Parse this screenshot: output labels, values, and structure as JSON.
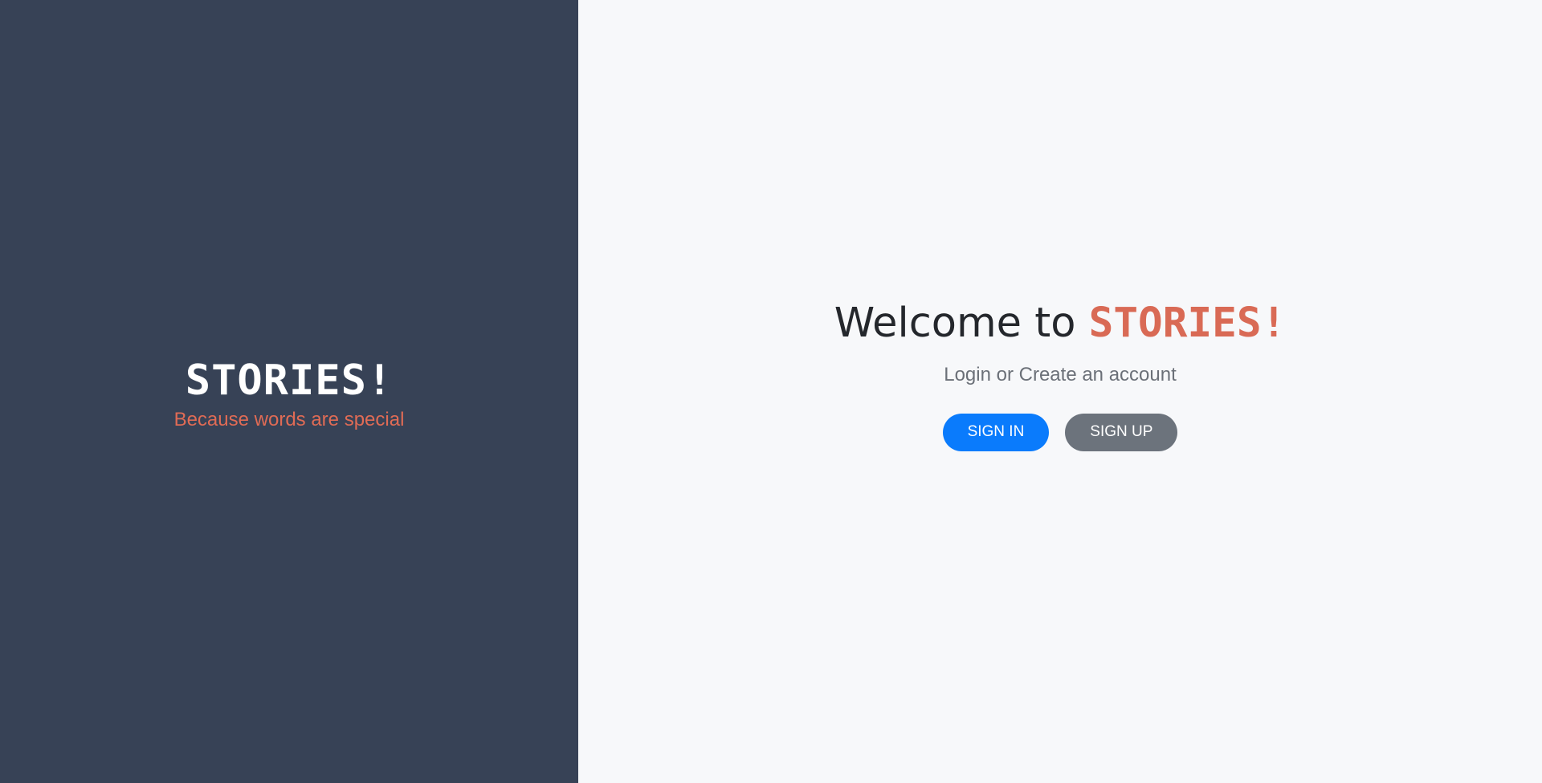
{
  "brand": {
    "name": "STORIES!",
    "tagline": "Because words are special"
  },
  "welcome": {
    "heading_prefix": "Welcome to ",
    "heading_brand": "STORIES!",
    "subtitle": "Login or Create an account"
  },
  "actions": {
    "sign_in_label": "SIGN IN",
    "sign_up_label": "SIGN UP"
  },
  "colors": {
    "sidebar_bg": "#374256",
    "accent": "#d96a55",
    "primary_button": "#0a7bfc",
    "secondary_button": "#6c737c",
    "page_bg": "#f7f8fa"
  }
}
